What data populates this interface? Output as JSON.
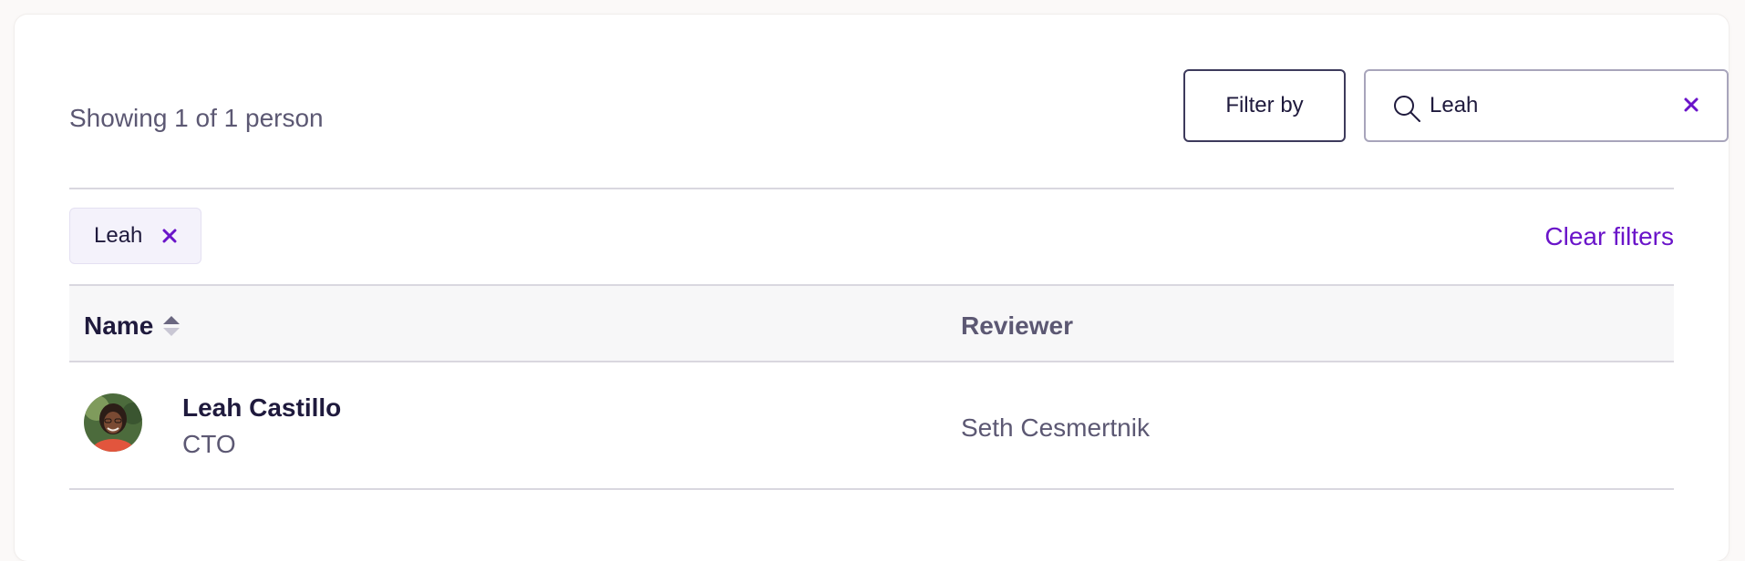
{
  "toolbar": {
    "count_text": "Showing 1 of 1 person",
    "filter_label": "Filter by",
    "search_value": "Leah"
  },
  "filters": {
    "chips": [
      {
        "label": "Leah"
      }
    ],
    "clear_label": "Clear filters"
  },
  "table": {
    "columns": [
      {
        "label": "Name",
        "sortable": true
      },
      {
        "label": "Reviewer",
        "sortable": false
      }
    ],
    "rows": [
      {
        "name": "Leah Castillo",
        "title": "CTO",
        "reviewer": "Seth Cesmertnik",
        "avatar": "person-photo"
      }
    ]
  },
  "icons": {
    "search": "search-icon",
    "clear": "close-icon",
    "chip_remove": "close-icon",
    "sort": "sort-icon"
  },
  "colors": {
    "accent": "#6a14c9",
    "text_primary": "#1f1a3d",
    "text_secondary": "#5c5873",
    "chip_bg": "#f4f2fb",
    "header_bg": "#f7f7f8"
  }
}
